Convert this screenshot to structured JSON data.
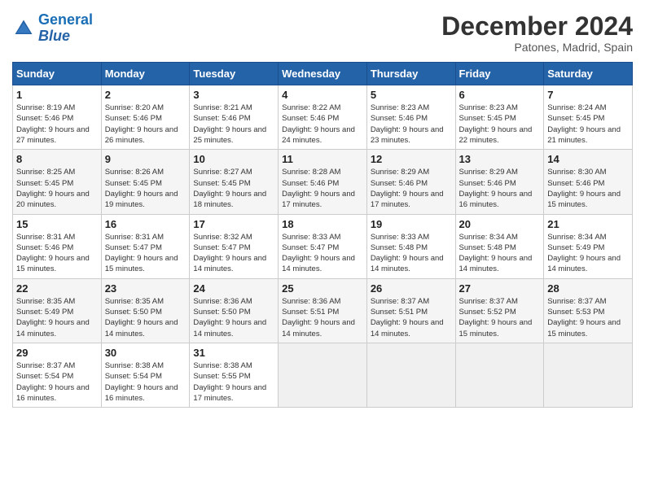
{
  "header": {
    "logo_line1": "General",
    "logo_line2": "Blue",
    "month_title": "December 2024",
    "location": "Patones, Madrid, Spain"
  },
  "weekdays": [
    "Sunday",
    "Monday",
    "Tuesday",
    "Wednesday",
    "Thursday",
    "Friday",
    "Saturday"
  ],
  "weeks": [
    [
      {
        "day": "1",
        "sunrise": "8:19 AM",
        "sunset": "5:46 PM",
        "daylight": "9 hours and 27 minutes."
      },
      {
        "day": "2",
        "sunrise": "8:20 AM",
        "sunset": "5:46 PM",
        "daylight": "9 hours and 26 minutes."
      },
      {
        "day": "3",
        "sunrise": "8:21 AM",
        "sunset": "5:46 PM",
        "daylight": "9 hours and 25 minutes."
      },
      {
        "day": "4",
        "sunrise": "8:22 AM",
        "sunset": "5:46 PM",
        "daylight": "9 hours and 24 minutes."
      },
      {
        "day": "5",
        "sunrise": "8:23 AM",
        "sunset": "5:46 PM",
        "daylight": "9 hours and 23 minutes."
      },
      {
        "day": "6",
        "sunrise": "8:23 AM",
        "sunset": "5:45 PM",
        "daylight": "9 hours and 22 minutes."
      },
      {
        "day": "7",
        "sunrise": "8:24 AM",
        "sunset": "5:45 PM",
        "daylight": "9 hours and 21 minutes."
      }
    ],
    [
      {
        "day": "8",
        "sunrise": "8:25 AM",
        "sunset": "5:45 PM",
        "daylight": "9 hours and 20 minutes."
      },
      {
        "day": "9",
        "sunrise": "8:26 AM",
        "sunset": "5:45 PM",
        "daylight": "9 hours and 19 minutes."
      },
      {
        "day": "10",
        "sunrise": "8:27 AM",
        "sunset": "5:45 PM",
        "daylight": "9 hours and 18 minutes."
      },
      {
        "day": "11",
        "sunrise": "8:28 AM",
        "sunset": "5:46 PM",
        "daylight": "9 hours and 17 minutes."
      },
      {
        "day": "12",
        "sunrise": "8:29 AM",
        "sunset": "5:46 PM",
        "daylight": "9 hours and 17 minutes."
      },
      {
        "day": "13",
        "sunrise": "8:29 AM",
        "sunset": "5:46 PM",
        "daylight": "9 hours and 16 minutes."
      },
      {
        "day": "14",
        "sunrise": "8:30 AM",
        "sunset": "5:46 PM",
        "daylight": "9 hours and 15 minutes."
      }
    ],
    [
      {
        "day": "15",
        "sunrise": "8:31 AM",
        "sunset": "5:46 PM",
        "daylight": "9 hours and 15 minutes."
      },
      {
        "day": "16",
        "sunrise": "8:31 AM",
        "sunset": "5:47 PM",
        "daylight": "9 hours and 15 minutes."
      },
      {
        "day": "17",
        "sunrise": "8:32 AM",
        "sunset": "5:47 PM",
        "daylight": "9 hours and 14 minutes."
      },
      {
        "day": "18",
        "sunrise": "8:33 AM",
        "sunset": "5:47 PM",
        "daylight": "9 hours and 14 minutes."
      },
      {
        "day": "19",
        "sunrise": "8:33 AM",
        "sunset": "5:48 PM",
        "daylight": "9 hours and 14 minutes."
      },
      {
        "day": "20",
        "sunrise": "8:34 AM",
        "sunset": "5:48 PM",
        "daylight": "9 hours and 14 minutes."
      },
      {
        "day": "21",
        "sunrise": "8:34 AM",
        "sunset": "5:49 PM",
        "daylight": "9 hours and 14 minutes."
      }
    ],
    [
      {
        "day": "22",
        "sunrise": "8:35 AM",
        "sunset": "5:49 PM",
        "daylight": "9 hours and 14 minutes."
      },
      {
        "day": "23",
        "sunrise": "8:35 AM",
        "sunset": "5:50 PM",
        "daylight": "9 hours and 14 minutes."
      },
      {
        "day": "24",
        "sunrise": "8:36 AM",
        "sunset": "5:50 PM",
        "daylight": "9 hours and 14 minutes."
      },
      {
        "day": "25",
        "sunrise": "8:36 AM",
        "sunset": "5:51 PM",
        "daylight": "9 hours and 14 minutes."
      },
      {
        "day": "26",
        "sunrise": "8:37 AM",
        "sunset": "5:51 PM",
        "daylight": "9 hours and 14 minutes."
      },
      {
        "day": "27",
        "sunrise": "8:37 AM",
        "sunset": "5:52 PM",
        "daylight": "9 hours and 15 minutes."
      },
      {
        "day": "28",
        "sunrise": "8:37 AM",
        "sunset": "5:53 PM",
        "daylight": "9 hours and 15 minutes."
      }
    ],
    [
      {
        "day": "29",
        "sunrise": "8:37 AM",
        "sunset": "5:54 PM",
        "daylight": "9 hours and 16 minutes."
      },
      {
        "day": "30",
        "sunrise": "8:38 AM",
        "sunset": "5:54 PM",
        "daylight": "9 hours and 16 minutes."
      },
      {
        "day": "31",
        "sunrise": "8:38 AM",
        "sunset": "5:55 PM",
        "daylight": "9 hours and 17 minutes."
      },
      null,
      null,
      null,
      null
    ]
  ]
}
